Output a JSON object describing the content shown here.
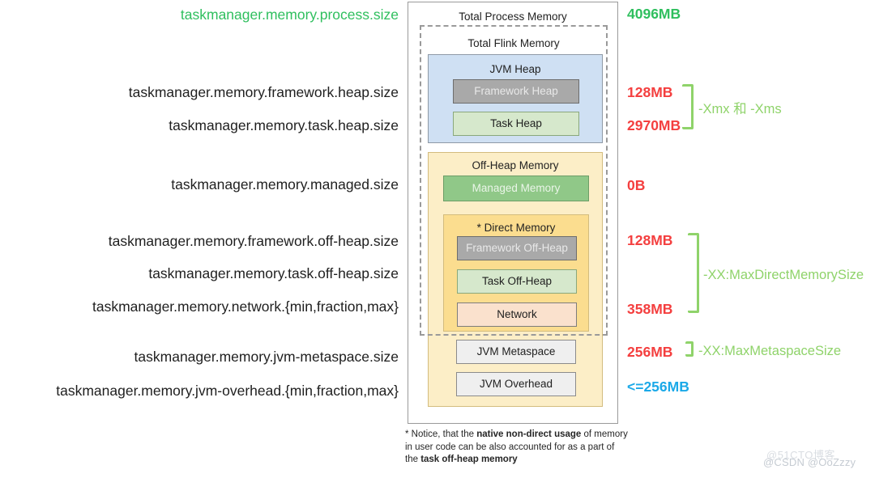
{
  "diagram": {
    "outer_title": "Total Process Memory",
    "flink_title": "Total Flink Memory",
    "jvm_heap_title": "JVM Heap",
    "off_heap_title": "Off-Heap Memory",
    "direct_memory_title": "* Direct Memory",
    "chips": {
      "framework_heap": "Framework Heap",
      "task_heap": "Task Heap",
      "managed_memory": "Managed Memory",
      "framework_off_heap": "Framework Off-Heap",
      "task_off_heap": "Task Off-Heap",
      "network": "Network",
      "jvm_metaspace": "JVM Metaspace",
      "jvm_overhead": "JVM Overhead"
    }
  },
  "left_labels": [
    {
      "text": "taskmanager.memory.process.size",
      "color": "#2fbf5e"
    },
    {
      "text": "taskmanager.memory.framework.heap.size",
      "color": "#1f1f1f"
    },
    {
      "text": "taskmanager.memory.task.heap.size",
      "color": "#1f1f1f"
    },
    {
      "text": "taskmanager.memory.managed.size",
      "color": "#1f1f1f"
    },
    {
      "text": "taskmanager.memory.framework.off-heap.size",
      "color": "#1f1f1f"
    },
    {
      "text": "taskmanager.memory.task.off-heap.size",
      "color": "#1f1f1f"
    },
    {
      "text": "taskmanager.memory.network.{min,fraction,max}",
      "color": "#1f1f1f"
    },
    {
      "text": "taskmanager.memory.jvm-metaspace.size",
      "color": "#1f1f1f"
    },
    {
      "text": "taskmanager.memory.jvm-overhead.{min,fraction,max}",
      "color": "#1f1f1f"
    }
  ],
  "right_values": [
    {
      "text": "4096MB",
      "color": "#2fbf5e"
    },
    {
      "text": "128MB",
      "color": "#f43f3f"
    },
    {
      "text": "2970MB",
      "color": "#f43f3f"
    },
    {
      "text": "0B",
      "color": "#f43f3f"
    },
    {
      "text": "128MB",
      "color": "#f43f3f"
    },
    {
      "text": "358MB",
      "color": "#f43f3f"
    },
    {
      "text": "256MB",
      "color": "#f43f3f"
    },
    {
      "text": "<=256MB",
      "color": "#1ba9e8"
    }
  ],
  "jvm_flags": [
    {
      "text": "-Xmx 和 -Xms"
    },
    {
      "text": "-XX:MaxDirectMemorySize"
    },
    {
      "text": "-XX:MaxMetaspaceSize"
    }
  ],
  "footnote": {
    "part1": "* Notice, that the ",
    "bold1": "native non-direct usage",
    "part2": " of memory in user code can be also accounted for as a part of the ",
    "bold2": "task off-heap memory"
  },
  "watermark": {
    "back": "@51CTO博客",
    "front": "@CSDN @OoZzzy"
  },
  "colors": {
    "green_accent": "#2fbf5e",
    "red_accent": "#f43f3f",
    "blue_accent": "#1ba9e8",
    "brace_green": "#8fd36a",
    "jvm_heap_fill": "#cfe0f3",
    "off_heap_fill": "#fceec7",
    "direct_memory_fill": "#fbdd8f"
  }
}
